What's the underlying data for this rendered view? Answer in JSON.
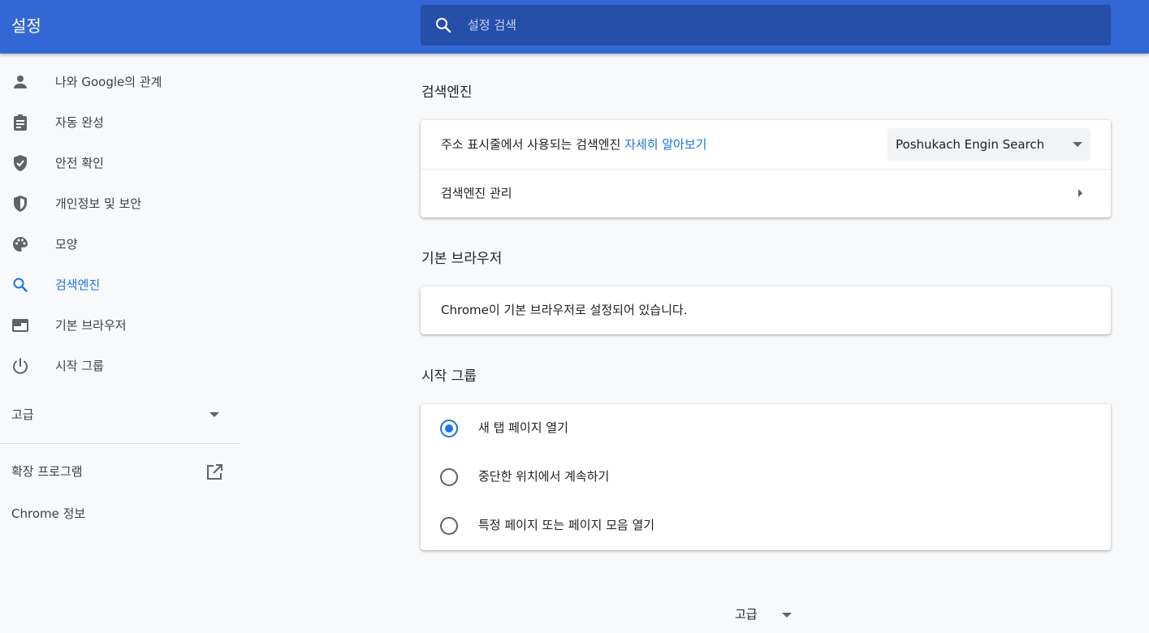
{
  "header": {
    "title": "설정",
    "search_placeholder": "설정 검색"
  },
  "sidebar": {
    "items": [
      {
        "label": "나와 Google의 관계",
        "icon": "person-icon"
      },
      {
        "label": "자동 완성",
        "icon": "clipboard-icon"
      },
      {
        "label": "안전 확인",
        "icon": "shield-check-icon"
      },
      {
        "label": "개인정보 및 보안",
        "icon": "shield-half-icon"
      },
      {
        "label": "모양",
        "icon": "palette-icon"
      },
      {
        "label": "검색엔진",
        "icon": "search-icon",
        "active": true
      },
      {
        "label": "기본 브라우저",
        "icon": "browser-window-icon"
      },
      {
        "label": "시작 그룹",
        "icon": "power-icon"
      }
    ],
    "advanced_label": "고급",
    "extensions_label": "확장 프로그램",
    "about_label": "Chrome 정보"
  },
  "sections": {
    "search_engine": {
      "title": "검색엔진",
      "row1_text": "주소 표시줄에서 사용되는 검색엔진",
      "learn_more": "자세히 알아보기",
      "selected_engine": "Poshukach Engin Search",
      "manage_label": "검색엔진 관리"
    },
    "default_browser": {
      "title": "기본 브라우저",
      "status_text": "Chrome이 기본 브라우저로 설정되어 있습니다."
    },
    "startup": {
      "title": "시작 그룹",
      "options": [
        {
          "label": "새 탭 페이지 열기",
          "checked": true
        },
        {
          "label": "중단한 위치에서 계속하기",
          "checked": false
        },
        {
          "label": "특정 페이지 또는 페이지 모음 열기",
          "checked": false
        }
      ]
    }
  },
  "footer": {
    "advanced_label": "고급"
  },
  "colors": {
    "header_bg": "#3367d6",
    "search_bg": "#254fa8",
    "accent": "#1a73e8",
    "page_bg": "#f8f9fa"
  }
}
